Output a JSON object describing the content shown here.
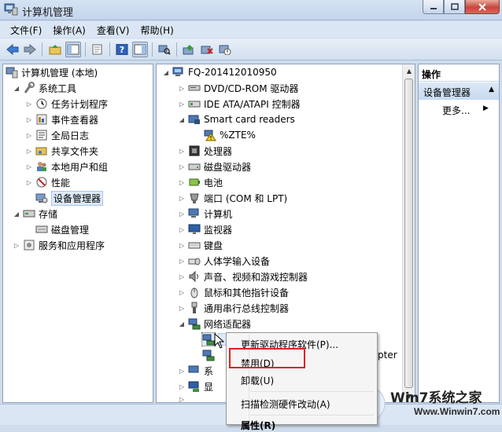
{
  "window": {
    "title": "计算机管理"
  },
  "menubar": [
    "文件(F)",
    "操作(A)",
    "查看(V)",
    "帮助(H)"
  ],
  "left_tree": [
    {
      "label": "计算机管理 (本地)",
      "level": 0,
      "expander": "",
      "icon": "computer-management-icon"
    },
    {
      "label": "系统工具",
      "level": 1,
      "expander": "◢",
      "icon": "system-tools-icon"
    },
    {
      "label": "任务计划程序",
      "level": 2,
      "expander": "▷",
      "icon": "task-scheduler-icon"
    },
    {
      "label": "事件查看器",
      "level": 2,
      "expander": "▷",
      "icon": "event-viewer-icon"
    },
    {
      "label": "全局日志",
      "level": 2,
      "expander": "▷",
      "icon": "global-log-icon"
    },
    {
      "label": "共享文件夹",
      "level": 2,
      "expander": "▷",
      "icon": "shared-folder-icon"
    },
    {
      "label": "本地用户和组",
      "level": 2,
      "expander": "▷",
      "icon": "users-groups-icon"
    },
    {
      "label": "性能",
      "level": 2,
      "expander": "▷",
      "icon": "performance-icon"
    },
    {
      "label": "设备管理器",
      "level": 2,
      "expander": "",
      "icon": "device-manager-icon",
      "selected": true
    },
    {
      "label": "存储",
      "level": 1,
      "expander": "◢",
      "icon": "storage-icon"
    },
    {
      "label": "磁盘管理",
      "level": 2,
      "expander": "",
      "icon": "disk-management-icon"
    },
    {
      "label": "服务和应用程序",
      "level": 1,
      "expander": "▷",
      "icon": "services-apps-icon"
    }
  ],
  "device_tree": [
    {
      "label": "FQ-201412010950",
      "level": 0,
      "expander": "◢",
      "icon": "computer-icon"
    },
    {
      "label": "DVD/CD-ROM 驱动器",
      "level": 1,
      "expander": "▷",
      "icon": "dvd-drive-icon"
    },
    {
      "label": "IDE ATA/ATAPI 控制器",
      "level": 1,
      "expander": "▷",
      "icon": "ide-controller-icon"
    },
    {
      "label": "Smart card readers",
      "level": 1,
      "expander": "◢",
      "icon": "smart-card-reader-icon"
    },
    {
      "label": "%ZTE%",
      "level": 2,
      "expander": "",
      "icon": "warning-device-icon"
    },
    {
      "label": "处理器",
      "level": 1,
      "expander": "▷",
      "icon": "processor-icon"
    },
    {
      "label": "磁盘驱动器",
      "level": 1,
      "expander": "▷",
      "icon": "disk-drive-icon"
    },
    {
      "label": "电池",
      "level": 1,
      "expander": "▷",
      "icon": "battery-icon"
    },
    {
      "label": "端口 (COM 和 LPT)",
      "level": 1,
      "expander": "▷",
      "icon": "port-icon"
    },
    {
      "label": "计算机",
      "level": 1,
      "expander": "▷",
      "icon": "computer-icon"
    },
    {
      "label": "监视器",
      "level": 1,
      "expander": "▷",
      "icon": "monitor-icon"
    },
    {
      "label": "键盘",
      "level": 1,
      "expander": "▷",
      "icon": "keyboard-icon"
    },
    {
      "label": "人体学输入设备",
      "level": 1,
      "expander": "▷",
      "icon": "hid-icon"
    },
    {
      "label": "声音、视频和游戏控制器",
      "level": 1,
      "expander": "▷",
      "icon": "sound-icon"
    },
    {
      "label": "鼠标和其他指针设备",
      "level": 1,
      "expander": "▷",
      "icon": "mouse-icon"
    },
    {
      "label": "通用串行总线控制器",
      "level": 1,
      "expander": "▷",
      "icon": "usb-icon"
    },
    {
      "label": "网络适配器",
      "level": 1,
      "expander": "◢",
      "icon": "network-adapter-icon"
    }
  ],
  "partial_labels": {
    "adapter_suffix": "pter",
    "row_a": "系",
    "row_b": "显"
  },
  "actions_pane": {
    "header": "操作",
    "section": "设备管理器",
    "more": "更多..."
  },
  "context_menu": {
    "update_driver": "更新驱动程序软件(P)...",
    "disable": "禁用(D)",
    "uninstall": "卸载(U)",
    "scan": "扫描检测硬件改动(A)",
    "properties": "属性(R)"
  },
  "watermark": {
    "brand": "Win7系统之家",
    "url": "Www.Winwin7.com"
  },
  "colors": {
    "highlight_box": "#e01f1f",
    "selection": "#dceaf8"
  }
}
